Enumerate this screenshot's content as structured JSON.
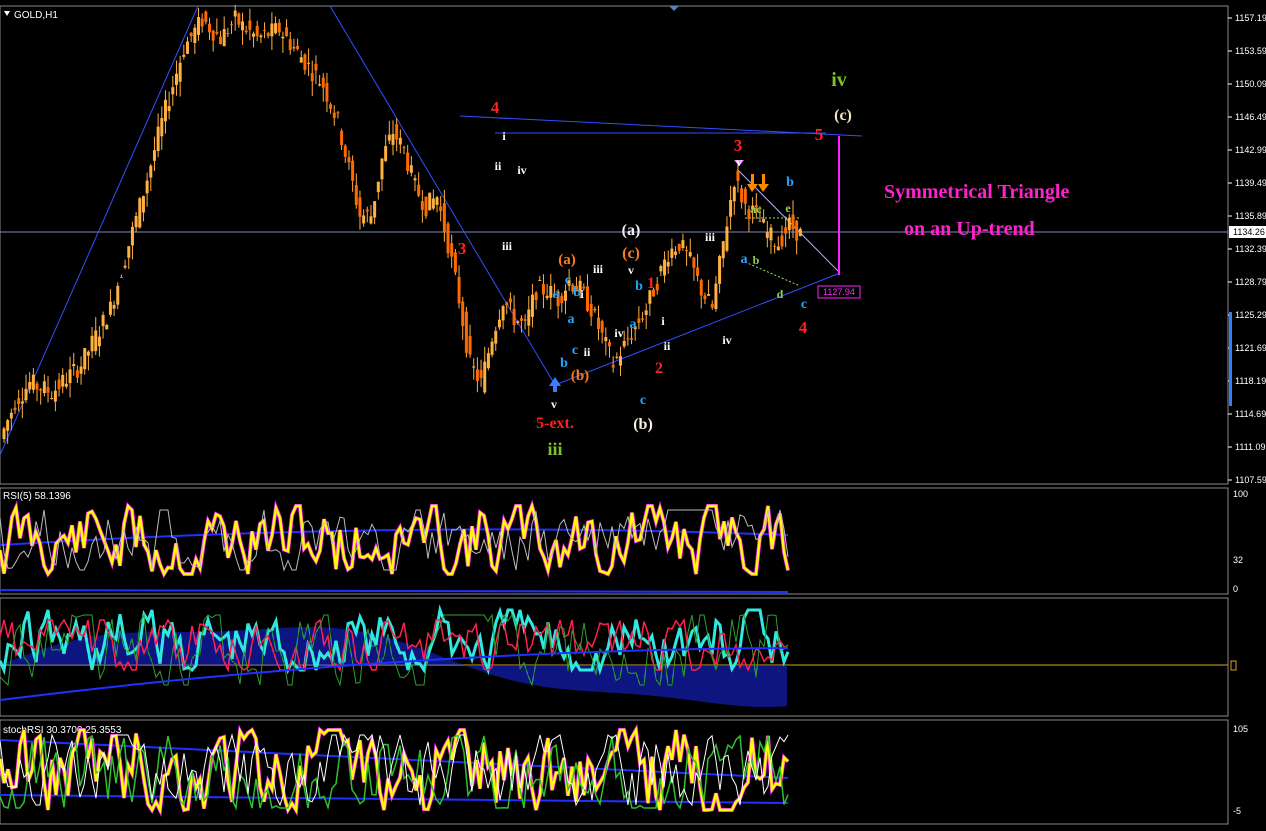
{
  "chart_data": {
    "type": "candlestick",
    "symbol_title": "GOLD,H1",
    "price_axis": {
      "ticks": [
        "1157.19",
        "1153.59",
        "1150.09",
        "1146.49",
        "1142.99",
        "1139.49",
        "1135.89",
        "1132.39",
        "1128.79",
        "1125.29",
        "1121.69",
        "1118.19",
        "1114.69",
        "1111.09",
        "1107.59"
      ],
      "current_price_label": "1134.26",
      "current_price": 1134.26,
      "marker_label": "1127.94",
      "range": [
        1107.59,
        1157.19
      ]
    },
    "price_path": [
      [
        0,
        1112
      ],
      [
        4,
        1116
      ],
      [
        8,
        1118
      ],
      [
        14,
        1117
      ],
      [
        22,
        1120
      ],
      [
        30,
        1126
      ],
      [
        38,
        1137
      ],
      [
        44,
        1146
      ],
      [
        50,
        1154
      ],
      [
        55,
        1157
      ],
      [
        60,
        1155
      ],
      [
        64,
        1157
      ],
      [
        70,
        1155
      ],
      [
        76,
        1156
      ],
      [
        82,
        1153
      ],
      [
        88,
        1150
      ],
      [
        92,
        1146
      ],
      [
        95,
        1141
      ],
      [
        98,
        1136
      ],
      [
        101,
        1136
      ],
      [
        104,
        1142
      ],
      [
        107,
        1145
      ],
      [
        110,
        1143
      ],
      [
        113,
        1139
      ],
      [
        116,
        1137
      ],
      [
        119,
        1138
      ],
      [
        122,
        1133
      ],
      [
        125,
        1127
      ],
      [
        128,
        1120
      ],
      [
        131,
        1118
      ],
      [
        134,
        1123
      ],
      [
        137,
        1127
      ],
      [
        140,
        1125
      ],
      [
        143,
        1124
      ],
      [
        146,
        1128
      ],
      [
        149,
        1128
      ],
      [
        152,
        1127
      ],
      [
        155,
        1129
      ],
      [
        158,
        1128
      ],
      [
        161,
        1126
      ],
      [
        164,
        1123
      ],
      [
        167,
        1120
      ],
      [
        170,
        1122
      ],
      [
        173,
        1124
      ],
      [
        176,
        1126
      ],
      [
        179,
        1129
      ],
      [
        182,
        1132
      ],
      [
        185,
        1133
      ],
      [
        188,
        1131
      ],
      [
        191,
        1128
      ],
      [
        194,
        1126
      ],
      [
        197,
        1133
      ],
      [
        200,
        1140
      ],
      [
        203,
        1137
      ],
      [
        206,
        1136
      ],
      [
        209,
        1134
      ],
      [
        212,
        1133
      ],
      [
        215,
        1135
      ],
      [
        218,
        1134
      ]
    ],
    "annotations": {
      "wave_labels": [
        {
          "text": "3",
          "color": "#ff2020",
          "size": 17
        },
        {
          "text": "4",
          "color": "#ff2020",
          "size": 17
        },
        {
          "text": "5-ext.",
          "color": "#ff2020",
          "size": 16
        },
        {
          "text": "iii",
          "color": "#7fbf2a",
          "size": 18
        },
        {
          "text": "(a)",
          "color": "#f0f0f0",
          "size": 16
        },
        {
          "text": "(c)",
          "color": "#ff7a1a",
          "size": 16
        },
        {
          "text": "(b)",
          "color": "#f5f0e0",
          "size": 16
        },
        {
          "text": "1",
          "color": "#ff2020",
          "size": 16
        },
        {
          "text": "2",
          "color": "#ff2020",
          "size": 16
        },
        {
          "text": "3",
          "color": "#ff2020",
          "size": 17
        },
        {
          "text": "4",
          "color": "#ff2020",
          "size": 17
        },
        {
          "text": "5",
          "color": "#ff2020",
          "size": 17
        },
        {
          "text": "iv",
          "color": "#7fbf2a",
          "size": 20
        },
        {
          "text": "(c)",
          "color": "#f5e6c8",
          "size": 16
        },
        {
          "text": "(a)",
          "color": "#ff7a1a",
          "size": 15
        },
        {
          "text": "(b)",
          "color": "#ff7a1a",
          "size": 15
        }
      ],
      "minor_labels": [
        {
          "text": "i",
          "color": "#ffffff"
        },
        {
          "text": "ii",
          "color": "#ffffff"
        },
        {
          "text": "iii",
          "color": "#ffffff"
        },
        {
          "text": "iv",
          "color": "#ffffff"
        },
        {
          "text": "v",
          "color": "#ffffff"
        },
        {
          "text": "i",
          "color": "#ffffff"
        },
        {
          "text": "ii",
          "color": "#ffffff"
        },
        {
          "text": "iii",
          "color": "#ffffff"
        },
        {
          "text": "iv",
          "color": "#ffffff"
        },
        {
          "text": "v",
          "color": "#ffffff"
        },
        {
          "text": "i",
          "color": "#ffffff"
        },
        {
          "text": "ii",
          "color": "#ffffff"
        },
        {
          "text": "iii",
          "color": "#ffffff"
        },
        {
          "text": "iv",
          "color": "#ffffff"
        },
        {
          "text": "v",
          "color": "#ffffff"
        },
        {
          "text": "a",
          "color": "#1fa8ff"
        },
        {
          "text": "b",
          "color": "#1fa8ff"
        },
        {
          "text": "c",
          "color": "#1fa8ff"
        },
        {
          "text": "a",
          "color": "#1fa8ff"
        },
        {
          "text": "b",
          "color": "#1fa8ff"
        },
        {
          "text": "c",
          "color": "#1fa8ff"
        },
        {
          "text": "a",
          "color": "#1fa8ff"
        },
        {
          "text": "b",
          "color": "#1fa8ff"
        },
        {
          "text": "c",
          "color": "#1fa8ff"
        },
        {
          "text": "a",
          "color": "#1fa8ff"
        },
        {
          "text": "b",
          "color": "#1fa8ff"
        },
        {
          "text": "c",
          "color": "#1fa8ff"
        },
        {
          "text": "ac",
          "color": "#8fd14f"
        },
        {
          "text": "e",
          "color": "#8fd14f"
        },
        {
          "text": "b",
          "color": "#8fd14f"
        },
        {
          "text": "d",
          "color": "#8fd14f"
        }
      ],
      "title_line1": "Symmetrical Triangle",
      "title_line2": "on an  Up-trend",
      "title_color": "#ff22cc"
    },
    "indicators": [
      {
        "name": "RSI(5) 58.1396",
        "levels": [
          "100",
          "32",
          "0"
        ]
      },
      {
        "name": "",
        "levels": []
      },
      {
        "name": "stochRSI 30.3700 25.3553",
        "levels": [
          "105",
          "-5"
        ]
      }
    ]
  },
  "colors": {
    "up": "#ff9a1a",
    "down": "#ff6a00",
    "wick": "#ff9a1a",
    "trend": "#3050ff",
    "grid": "#ffffff",
    "rsi": "#ffff00",
    "rsi_shadow": "#ff22ff",
    "macd_hist": "#1a2cff",
    "macd_line": "#30e8e0",
    "signal": "#ff2050"
  }
}
